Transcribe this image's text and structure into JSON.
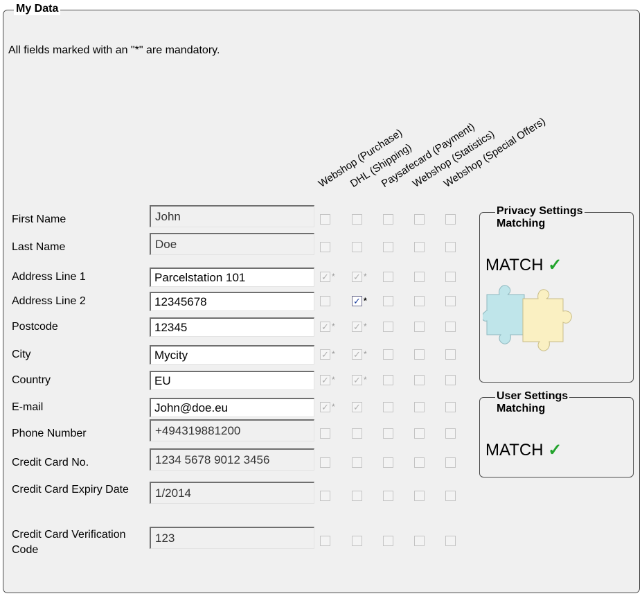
{
  "group": {
    "title": "My Data"
  },
  "note": "All fields marked with an \"*\" are mandatory.",
  "columns": [
    "Webshop (Purchase)",
    "DHL (Shipping)",
    "Paysafecard (Payment)",
    "Webshop (Statistics)",
    "Webshop (Special Offers)"
  ],
  "rows": [
    {
      "label": "First Name",
      "value": "John",
      "editable": false,
      "checks": [
        "off",
        "off",
        "off",
        "off",
        "off"
      ]
    },
    {
      "label": "Last Name",
      "value": "Doe",
      "editable": false,
      "checks": [
        "off",
        "off",
        "off",
        "off",
        "off"
      ]
    },
    {
      "label": "Address Line 1",
      "value": "Parcelstation 101",
      "editable": true,
      "checks": [
        "on*",
        "on*",
        "off",
        "off",
        "off"
      ]
    },
    {
      "label": "Address Line 2",
      "value": "12345678",
      "editable": true,
      "checks": [
        "off",
        "active*",
        "off",
        "off",
        "off"
      ]
    },
    {
      "label": "Postcode",
      "value": "12345",
      "editable": true,
      "checks": [
        "on*",
        "on*",
        "off",
        "off",
        "off"
      ]
    },
    {
      "label": "City",
      "value": "Mycity",
      "editable": true,
      "checks": [
        "on*",
        "on*",
        "off",
        "off",
        "off"
      ]
    },
    {
      "label": "Country",
      "value": "EU",
      "editable": true,
      "checks": [
        "on*",
        "on*",
        "off",
        "off",
        "off"
      ]
    },
    {
      "label": "E-mail",
      "value": "John@doe.eu",
      "editable": true,
      "checks": [
        "on*",
        "on",
        "off",
        "off",
        "off"
      ]
    },
    {
      "label": "Phone Number",
      "value": "+494319881200",
      "editable": false,
      "checks": [
        "off",
        "off",
        "off",
        "off",
        "off"
      ]
    },
    {
      "label": "Credit Card No.",
      "value": "1234 5678 9012 3456",
      "editable": false,
      "checks": [
        "off",
        "off",
        "off",
        "off",
        "off"
      ]
    },
    {
      "label": "Credit Card Expiry Date",
      "value": "1/2014",
      "editable": false,
      "checks": [
        "off",
        "off",
        "off",
        "off",
        "off"
      ]
    },
    {
      "label": "Credit Card Verification Code",
      "value": "123",
      "editable": false,
      "checks": [
        "off",
        "off",
        "off",
        "off",
        "off"
      ]
    }
  ],
  "privacy": {
    "title": "Privacy Settings Matching",
    "status": "MATCH",
    "check_glyph": "✓",
    "icon": "puzzle-pieces-icon"
  },
  "user": {
    "title": "User Settings Matching",
    "status": "MATCH",
    "check_glyph": "✓"
  },
  "colors": {
    "match_check": "#21a32b",
    "checked_mark": "#1c3f9e"
  }
}
